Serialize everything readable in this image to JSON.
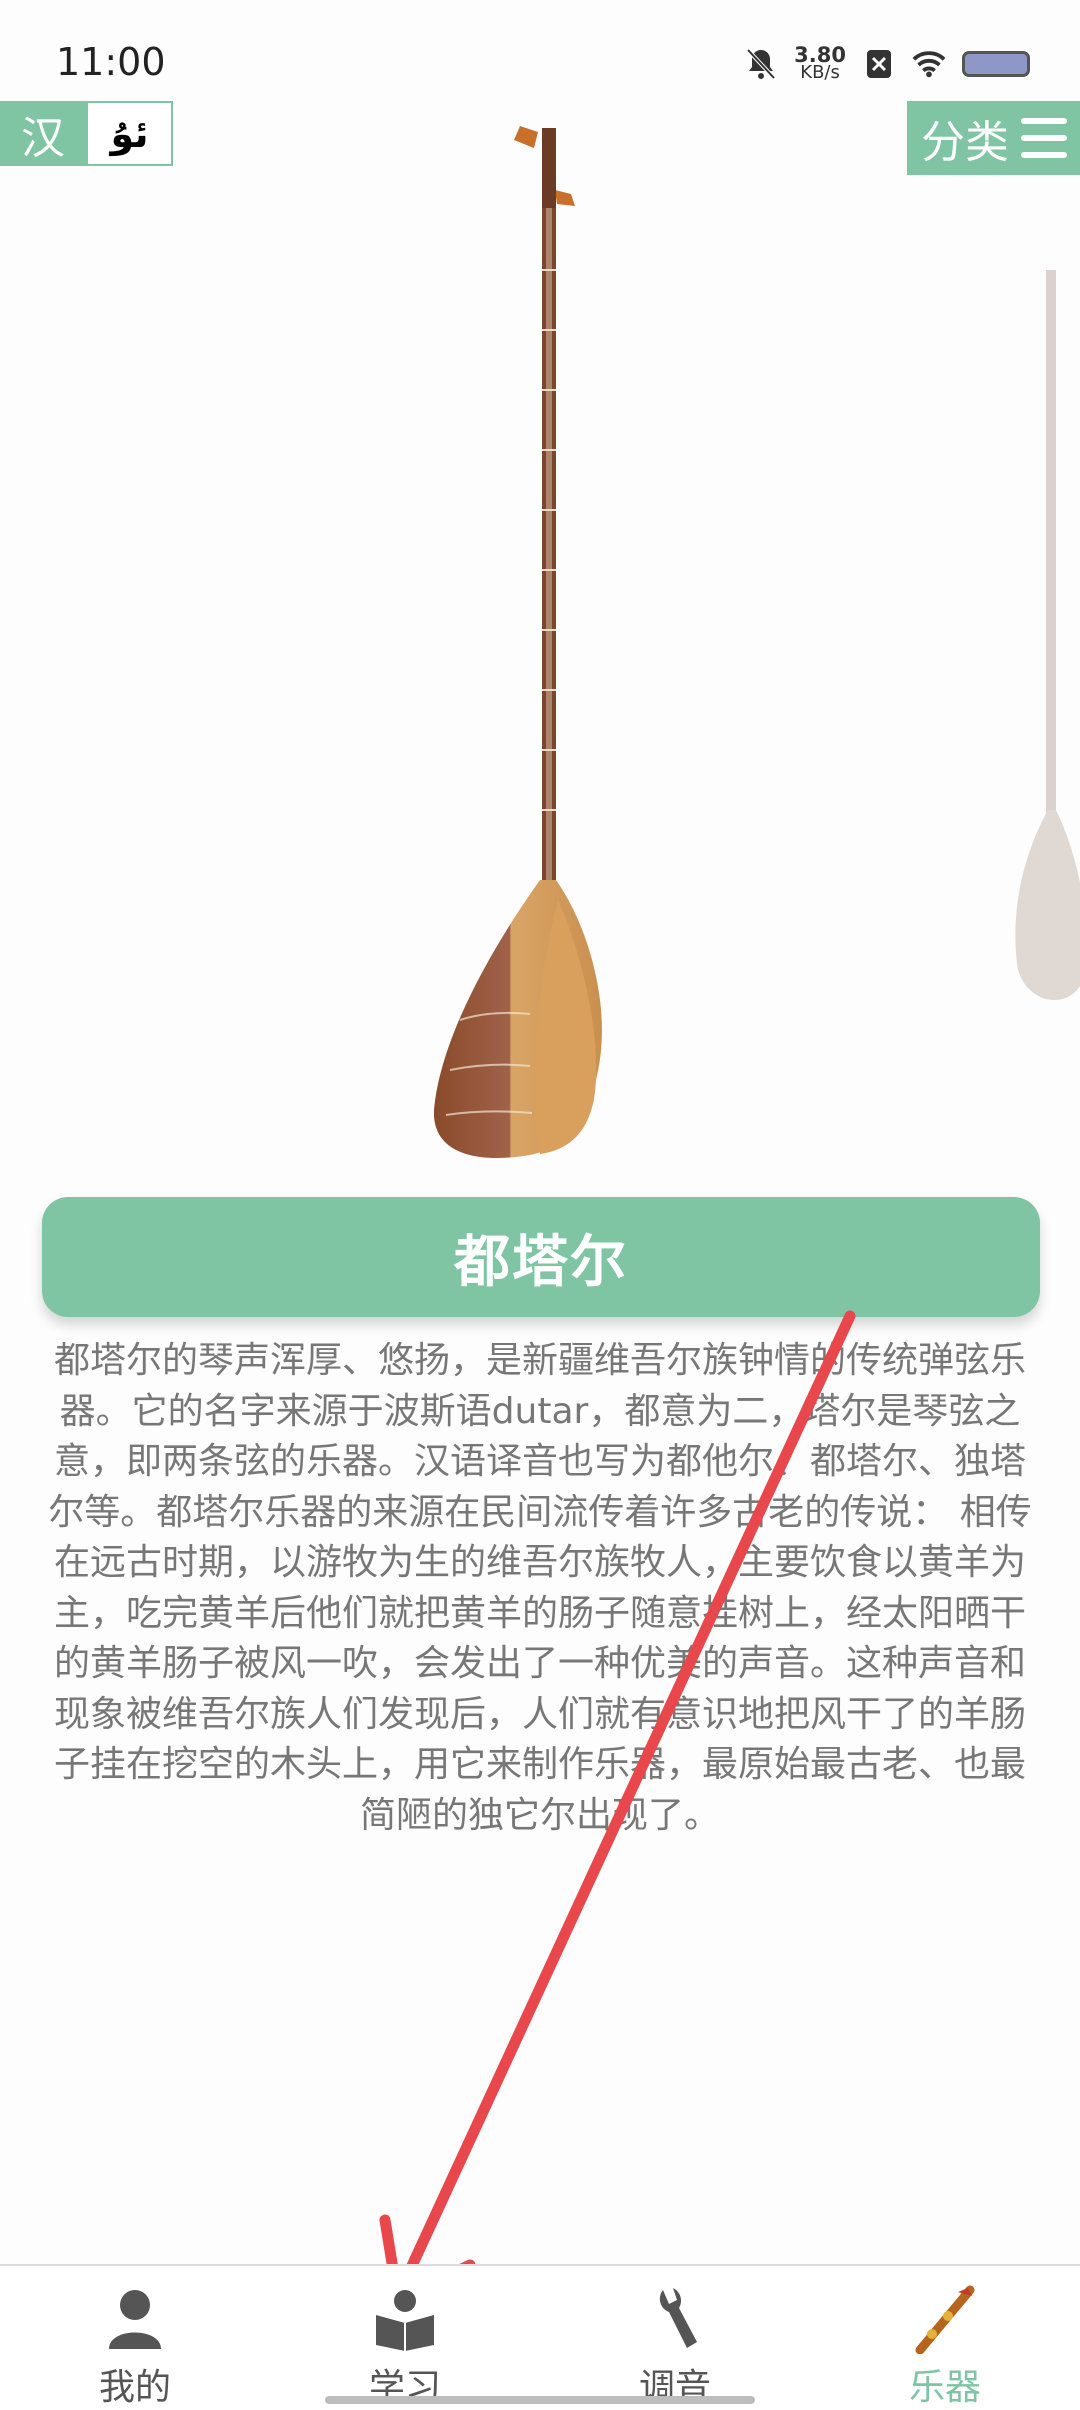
{
  "status_bar": {
    "time": "11:00",
    "net_speed_value": "3.80",
    "net_speed_unit": "KB/s",
    "icons": [
      "bell-muted-icon",
      "sim-off-icon",
      "wifi-icon",
      "battery-icon"
    ]
  },
  "header": {
    "lang_han": "汉",
    "lang_uyghur": "ئۇ",
    "category_label": "分类",
    "menu_icon": "hamburger-menu-icon"
  },
  "instrument": {
    "name": "都塔尔",
    "description": "都塔尔的琴声浑厚、悠扬，是新疆维吾尔族钟情的传统弹弦乐器。它的名字来源于波斯语dutar，都意为二，塔尔是琴弦之意，即两条弦的乐器。汉语译音也写为都他尔、都塔尔、独塔尔等。都塔尔乐器的来源在民间流传着许多古老的传说： 相传在远古时期，以游牧为生的维吾尔族牧人，主要饮食以黄羊为主，吃完黄羊后他们就把黄羊的肠子随意挂树上，经太阳晒干的黄羊肠子被风一吹，会发出了一种优美的声音。这种声音和现象被维吾尔族人们发现后，人们就有意识地把风干了的羊肠子挂在挖空的木头上，用它来制作乐器，最原始最古老、也最简陋的独它尔出现了。"
  },
  "bottom_nav": [
    {
      "label": "我的",
      "icon": "person-icon",
      "active": false
    },
    {
      "label": "学习",
      "icon": "book-reader-icon",
      "active": false
    },
    {
      "label": "调音",
      "icon": "wrench-icon",
      "active": false
    },
    {
      "label": "乐器",
      "icon": "instrument-icon",
      "active": true
    }
  ],
  "colors": {
    "accent": "#7fc5a3",
    "text_gray": "#777777",
    "annotation_arrow": "#e8474b"
  }
}
